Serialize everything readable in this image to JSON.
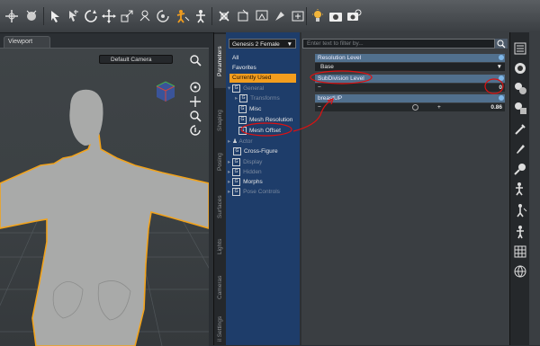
{
  "viewport": {
    "tab_label": "Viewport",
    "camera": "Default Camera"
  },
  "side_tabs": [
    "Parameters",
    "Shaping",
    "Posing",
    "Surfaces",
    "Lights",
    "Cameras",
    "il Settings"
  ],
  "parameters": {
    "node": "Genesis 2 Female",
    "filters": [
      "All",
      "Favorites",
      "Currently Used"
    ],
    "selected_filter": "Currently Used",
    "tree": [
      {
        "label": "General",
        "dim": true
      },
      {
        "label": "Transforms",
        "dim": true
      },
      {
        "label": "Misc",
        "dim": false
      },
      {
        "label": "Mesh Resolution",
        "dim": false
      },
      {
        "label": "Mesh Offset",
        "dim": false
      },
      {
        "label": "Actor",
        "dim": true
      },
      {
        "label": "Cross-Figure",
        "dim": false
      },
      {
        "label": "Display",
        "dim": true
      },
      {
        "label": "Hidden",
        "dim": true
      },
      {
        "label": "Morphs",
        "dim": false
      },
      {
        "label": "Pose Controls",
        "dim": true
      }
    ],
    "filter_placeholder": "Enter text to filter by...",
    "properties": [
      {
        "name": "Resolution Level",
        "type": "combo",
        "value": "Base"
      },
      {
        "name": "SubDivision Level",
        "type": "slider",
        "value": "0",
        "fraction": 0.0
      },
      {
        "name": "breastUP",
        "type": "slider",
        "value": "0.86",
        "fraction": 0.86
      }
    ]
  },
  "colors": {
    "accent": "#f29d1e",
    "tree_bg": "#1e3d6a",
    "header_bg": "#51708e",
    "annotation": "#e01010"
  }
}
